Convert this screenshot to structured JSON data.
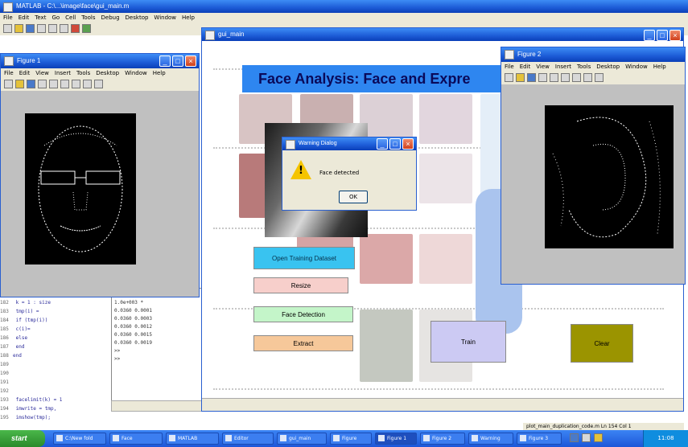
{
  "code_window": {
    "title": "MATLAB - C:\\...\\image\\face\\gui_main.m",
    "menu": [
      "File",
      "Edit",
      "Text",
      "Go",
      "Cell",
      "Tools",
      "Debug",
      "Desktop",
      "Window",
      "Help"
    ],
    "line_numbers": [
      "181",
      "182",
      "183",
      "184",
      "185",
      "186",
      "187",
      "188",
      "189",
      "190",
      "191",
      "192",
      "193",
      "194",
      "195"
    ],
    "code": [
      "end",
      "  k = 1 : size",
      "  tmp(i) =",
      "  if (tmp(i))",
      "    c(i)=",
      "    else",
      "  end",
      "end",
      "",
      "",
      "",
      "",
      "  facelimit(k) = 1",
      "  imwrite = tmp,",
      "  imshow(tmp);"
    ],
    "cmd": [
      ">> ",
      "  1.0e+003 *",
      "  0.0360   0.0001",
      "  0.0360   0.0003",
      "  0.0360   0.0012",
      "  0.0360   0.0015",
      "  0.0360   0.0019",
      "  >>",
      ">>"
    ]
  },
  "gui_window": {
    "title": "gui_main",
    "banner": "Face Analysis: Face and Expre",
    "buttons": {
      "open_label": "Open Training Dataset",
      "resize_label": "Resize",
      "face_detection_label": "Face Detection",
      "extract_label": "Extract",
      "train_label": "Train",
      "clear_label": "Clear"
    }
  },
  "dialog": {
    "title": "Warning Dialog",
    "message": "Face detected",
    "ok_label": "OK"
  },
  "figure_left": {
    "title": "Figure 1",
    "menu": [
      "File",
      "Edit",
      "View",
      "Insert",
      "Tools",
      "Desktop",
      "Window",
      "Help"
    ]
  },
  "figure_right": {
    "title": "Figure 2",
    "menu": [
      "File",
      "Edit",
      "View",
      "Insert",
      "Tools",
      "Desktop",
      "Window",
      "Help"
    ]
  },
  "status": {
    "text": "plot_main_duplication_code.m  Ln 154  Col 1"
  },
  "taskbar": {
    "start_label": "start",
    "tasks": [
      "C:\\New fold",
      "Face",
      "MATLAB",
      "Editor",
      "gui_main",
      "Figure",
      "Figure 1",
      "Figure 2",
      "Warning",
      "Figure 3"
    ],
    "clock": "11:08"
  },
  "colors": {
    "banner": "#2e86f0",
    "open_button": "#39c3f0",
    "resize_button": "#f7cfcb",
    "detect_button": "#c4f5c9",
    "extract_button": "#f6c89a",
    "train_button": "#cccaf3",
    "clear_button": "#9b9400",
    "xp_title": "#1c5bd6"
  }
}
